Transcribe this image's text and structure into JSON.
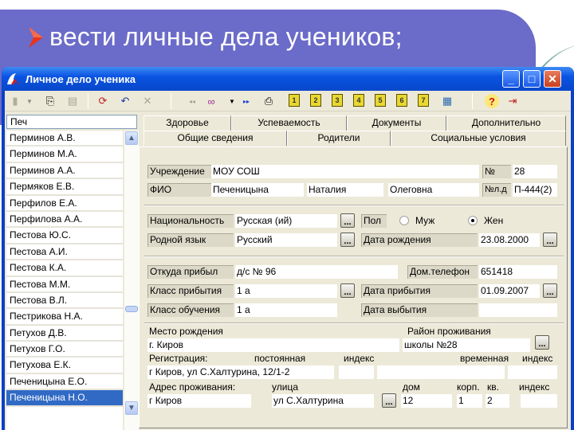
{
  "slide": {
    "bullet_text": "вести личные дела учеников;",
    "banner_color": "#6b6bc9"
  },
  "window": {
    "title": "Личное дело ученика",
    "controls": {
      "minimize": "_",
      "maximize": "□",
      "close": "✕"
    }
  },
  "toolbar": {
    "icons": [
      "new-doc-icon",
      "dropdown-arrow-icon",
      "copy-icon",
      "list-icon",
      "refresh-icon",
      "undo-icon",
      "delete-icon",
      "prev-icon",
      "binoculars-icon",
      "dropdown-arrow-icon",
      "next-icon",
      "print-icon",
      "page-1-icon",
      "page-2-icon",
      "page-3-icon",
      "page-4-icon",
      "page-5-icon",
      "page-6-icon",
      "page-7-icon",
      "report-icon",
      "help-icon",
      "exit-icon"
    ],
    "page_numbers": [
      "1",
      "2",
      "3",
      "4",
      "5",
      "6",
      "7"
    ],
    "help_glyph": "?"
  },
  "search": {
    "value": "Печ"
  },
  "students": [
    "Перминов А.В.",
    "Перминов М.А.",
    "Перминов А.А.",
    "Пермяков Е.В.",
    "Перфилов Е.А.",
    "Перфилова А.А.",
    "Пестова Ю.С.",
    "Пестова А.И.",
    "Пестова К.А.",
    "Пестова М.М.",
    "Пестова В.Л.",
    "Пестрикова Н.А.",
    "Петухов Д.В.",
    "Петухов Г.О.",
    "Петухова Е.К.",
    "Печеницына Е.О.",
    "Печеницына Н.О."
  ],
  "selected_student": "Печеницына Н.О.",
  "tabs_back": [
    "Здоровье",
    "Успеваемость",
    "Документы",
    "Дополнительно"
  ],
  "tabs_front": [
    "Общие сведения",
    "Родители",
    "Социальные условия"
  ],
  "active_tab": "Общие сведения",
  "form": {
    "institution_label": "Учреждение",
    "institution_value": "МОУ СОШ",
    "number_label": "№",
    "number_value": "28",
    "fio_label": "ФИО",
    "last_name": "Печеницына",
    "first_name": "Наталия",
    "patronymic": "Олеговна",
    "file_no_label": "№л.д",
    "file_no_value": "П-444(2)",
    "nationality_label": "Национальность",
    "nationality_value": "Русская (ий)",
    "sex_label": "Пол",
    "sex_male": "Муж",
    "sex_female": "Жен",
    "sex_selected": "Жен",
    "language_label": "Родной язык",
    "language_value": "Русский",
    "birth_date_label": "Дата рождения",
    "birth_date_value": "23.08.2000",
    "from_label": "Откуда прибыл",
    "from_value": "д/с № 96",
    "phone_label": "Дом.телефон",
    "phone_value": "651418",
    "arrival_class_label": "Класс прибытия",
    "arrival_class_value": "1 а",
    "arrival_date_label": "Дата прибытия",
    "arrival_date_value": "01.09.2007",
    "study_class_label": "Класс обучения",
    "study_class_value": "1 а",
    "leave_date_label": "Дата выбытия",
    "leave_date_value": "",
    "birthplace_label": "Место рождения",
    "birthplace_value": "г. Киров",
    "district_label": "Район проживания",
    "district_value": "школы №28",
    "registration_label": "Регистрация:",
    "permanent_label": "постоянная",
    "index_label": "индекс",
    "temporary_label": "временная",
    "registration_value": "г Киров, ул С.Халтурина,  12/1-2",
    "reg_index_value": "",
    "temp_value": "",
    "temp_index_value": "",
    "address_label": "Адрес проживания:",
    "street_label": "улица",
    "house_label": "дом",
    "building_label": "корп.",
    "apt_label": "кв.",
    "addr_index_label": "индекс",
    "city_value": "г Киров",
    "street_value": "ул С.Халтурина",
    "house_value": "12",
    "building_value": "1",
    "apt_value": "2",
    "addr_index_value": "",
    "ellipsis": "..."
  }
}
